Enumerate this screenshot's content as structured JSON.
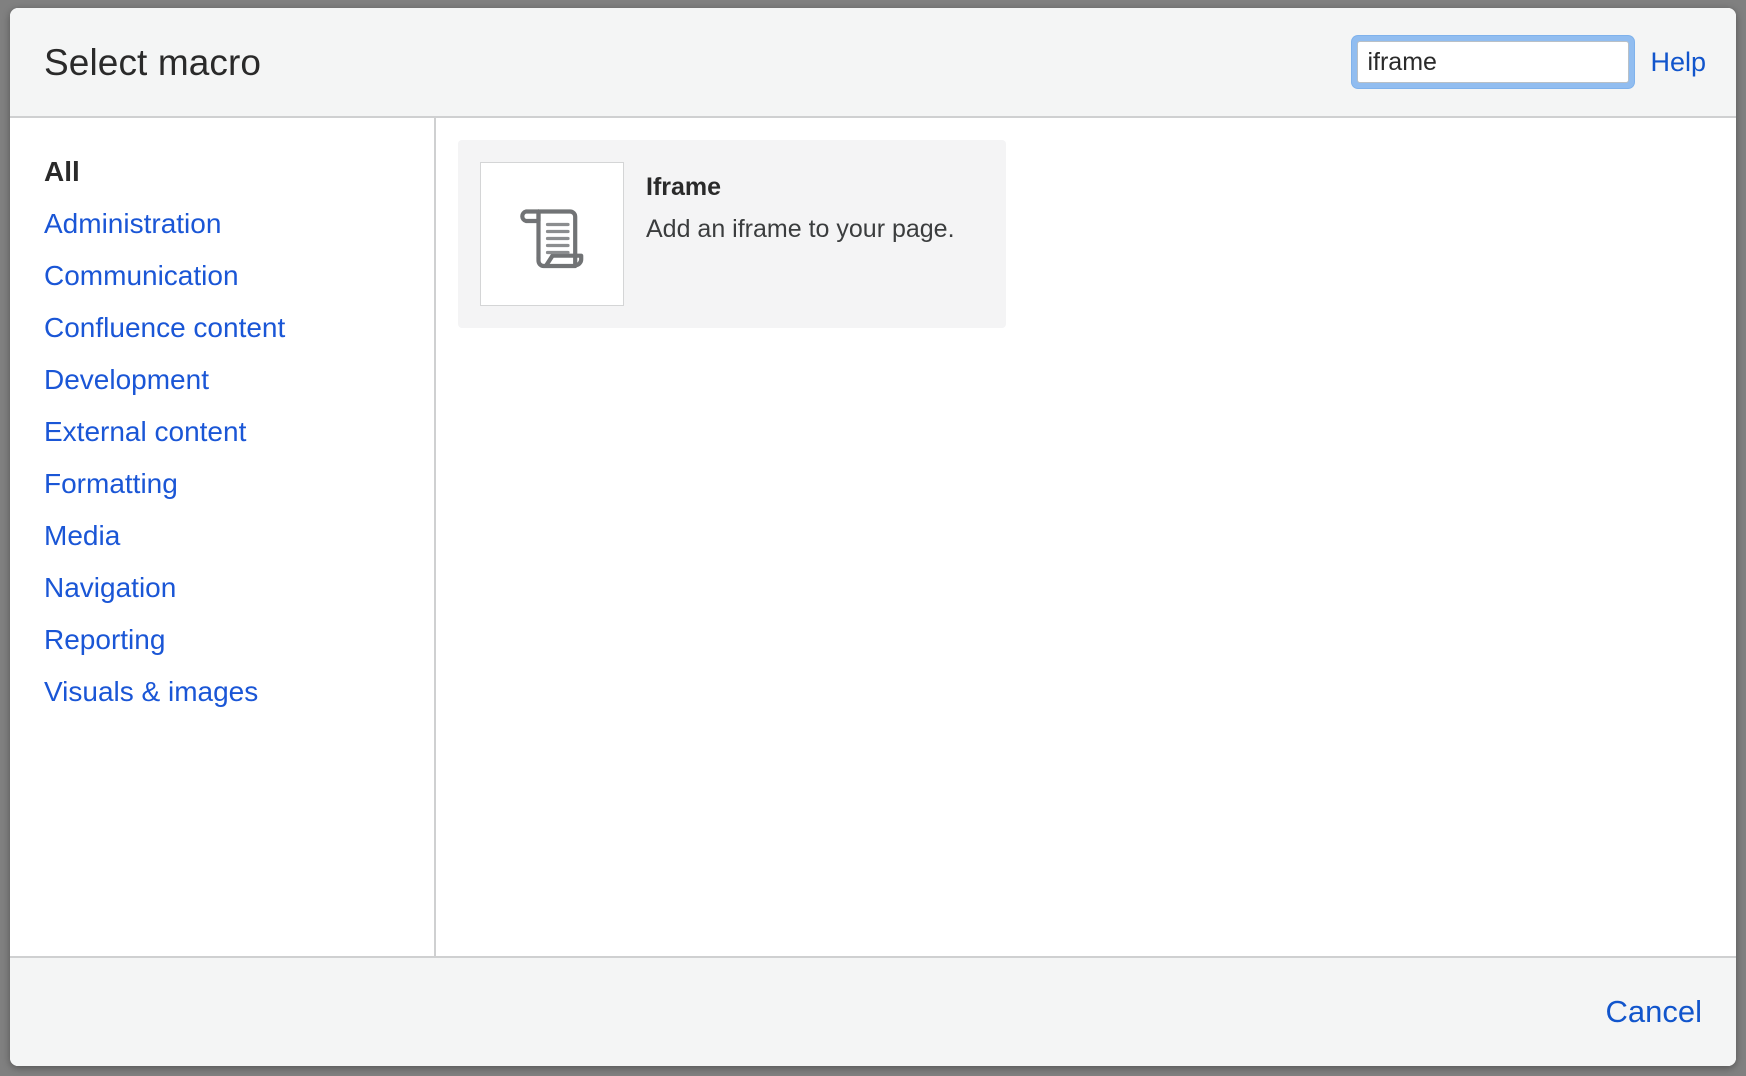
{
  "dialog": {
    "title": "Select macro"
  },
  "search": {
    "value": "iframe",
    "placeholder": "",
    "help_label": "Help",
    "icon": "search-input"
  },
  "sidebar": {
    "items": [
      {
        "label": "All",
        "active": true
      },
      {
        "label": "Administration",
        "active": false
      },
      {
        "label": "Communication",
        "active": false
      },
      {
        "label": "Confluence content",
        "active": false
      },
      {
        "label": "Development",
        "active": false
      },
      {
        "label": "External content",
        "active": false
      },
      {
        "label": "Formatting",
        "active": false
      },
      {
        "label": "Media",
        "active": false
      },
      {
        "label": "Navigation",
        "active": false
      },
      {
        "label": "Reporting",
        "active": false
      },
      {
        "label": "Visuals & images",
        "active": false
      }
    ]
  },
  "results": {
    "macros": [
      {
        "title": "Iframe",
        "description": "Add an iframe to your page.",
        "icon": "scroll-document-icon"
      }
    ]
  },
  "footer": {
    "cancel_label": "Cancel"
  },
  "colors": {
    "link": "#1a56d6",
    "focus_ring": "#91bdf0",
    "header_bg": "#f4f5f5",
    "card_bg": "#f4f4f5",
    "backdrop": "#808080"
  }
}
